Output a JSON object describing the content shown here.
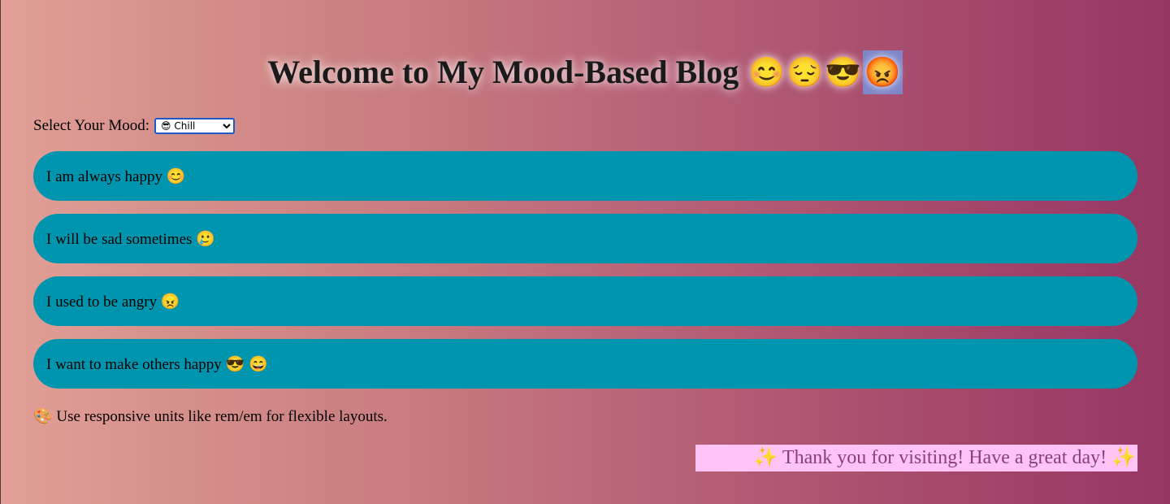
{
  "header": {
    "title": "Welcome to My Mood-Based Blog",
    "emojis": [
      "😊",
      "😔",
      "😎",
      "😡"
    ]
  },
  "mood": {
    "label": "Select Your Mood:",
    "selected": "😎 Chill"
  },
  "posts": [
    {
      "text": "I am always happy 😊"
    },
    {
      "text": "I will be sad sometimes 🥲"
    },
    {
      "text": "I used to be angry 😠"
    },
    {
      "text": "I want to make others happy 😎 😄"
    }
  ],
  "tip": "🎨 Use responsive units like rem/em for flexible layouts.",
  "footer": {
    "thanks": "✨ Thank you for visiting! Have a great day! ✨"
  },
  "colors": {
    "post_background": "#0095ae",
    "footer_background": "#ffc3f6",
    "footer_text": "#8a3f7a",
    "selected_emoji_highlight": "#7f86c8"
  }
}
